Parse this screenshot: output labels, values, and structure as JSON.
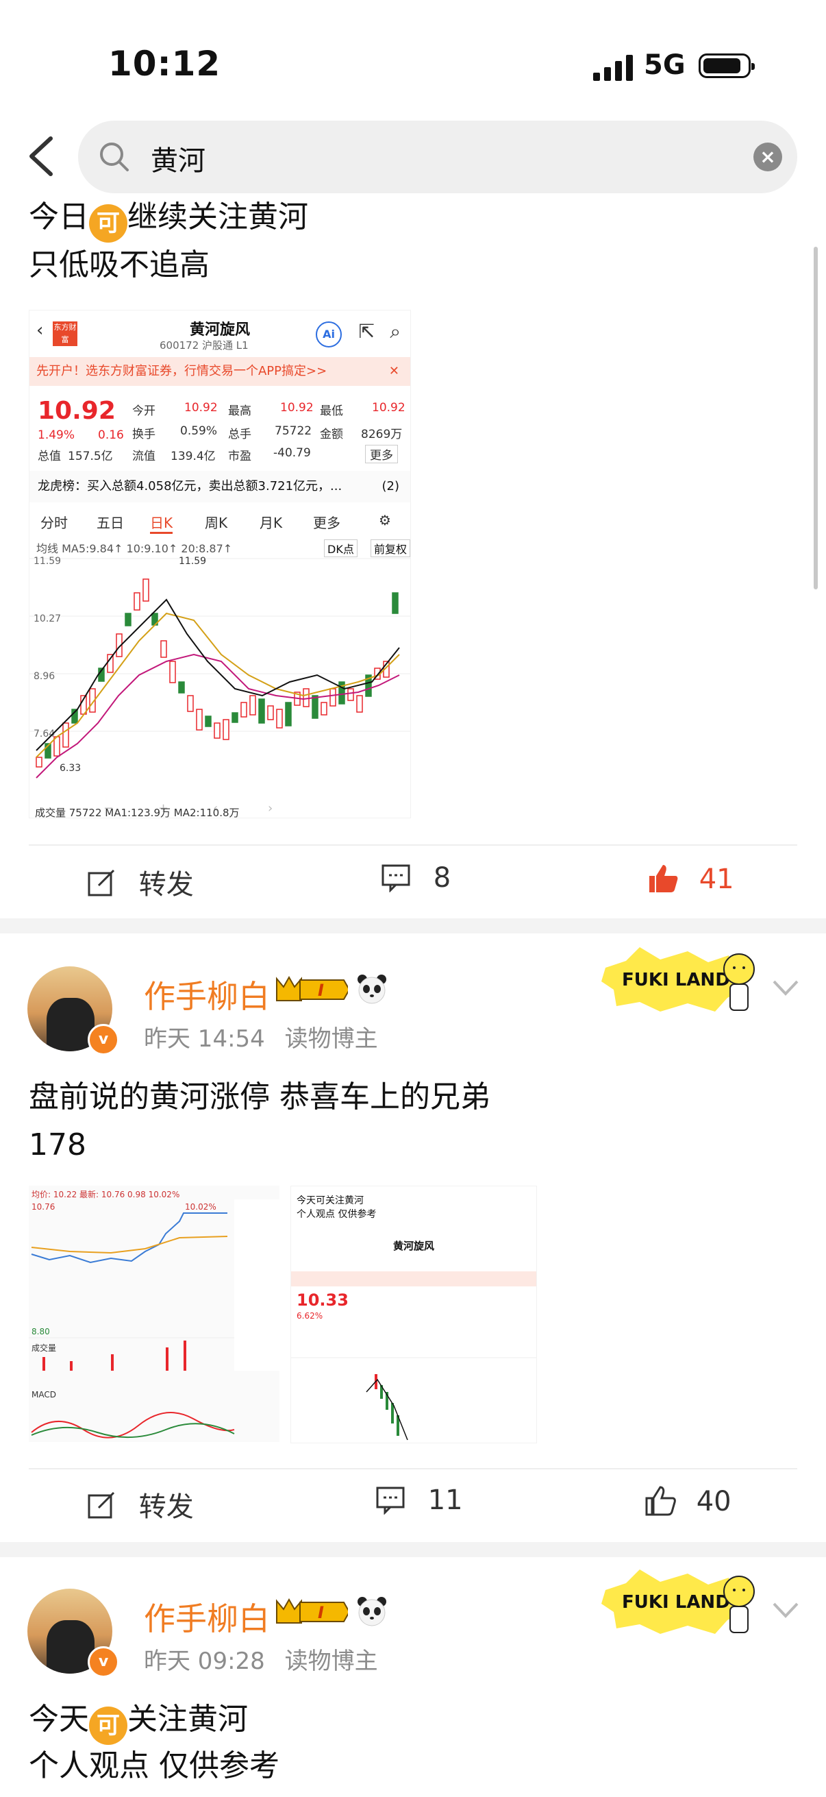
{
  "status_bar": {
    "time": "10:12",
    "network": "5G"
  },
  "search": {
    "query": "黄河"
  },
  "post1": {
    "line1_a": "今日",
    "line1_icon": "可",
    "line1_b": "继续关注黄河",
    "line2": "只低吸不追高",
    "card": {
      "logo": "东方财富",
      "stock_name": "黄河旋风",
      "stock_code": "600172 沪股通 L1",
      "banner": "先开户！选东方财富证券，行情交易一个APP搞定>>",
      "price": "10.92",
      "pct": "1.49%",
      "change": "0.16",
      "fields": [
        {
          "k": "今开",
          "v": "10.92"
        },
        {
          "k": "最高",
          "v": "10.92"
        },
        {
          "k": "最低",
          "v": "10.92"
        },
        {
          "k": "换手",
          "v": "0.59%"
        },
        {
          "k": "总手",
          "v": "75722"
        },
        {
          "k": "金额",
          "v": "8269万"
        },
        {
          "k": "总值",
          "v": "157.5亿"
        },
        {
          "k": "流值",
          "v": "139.4亿"
        },
        {
          "k": "市盈",
          "v": "-40.79"
        }
      ],
      "more": "更多",
      "dragon": "龙虎榜：买入总额4.058亿元，卖出总额3.721亿元，...",
      "dragon_count": "(2)",
      "tabs": [
        "分时",
        "五日",
        "日K",
        "周K",
        "月K",
        "更多"
      ],
      "ma_line": "均线 MA5:9.84↑ 10:9.10↑ 20:8.87↑",
      "dk": "DK点",
      "fq": "前复权",
      "y_ticks": [
        "11.59",
        "10.27",
        "8.96",
        "7.64"
      ],
      "hi_label": "11.59",
      "lo_label": "6.33",
      "volume_line": "成交量 75722 MA1:123.9万 MA2:110.8万"
    },
    "actions": {
      "repost": "转发",
      "comments": "8",
      "likes": "41"
    }
  },
  "post2": {
    "author": "作手柳白",
    "level": "I",
    "time": "昨天 14:54",
    "role": "读物博主",
    "decor": "FUKI LAND",
    "text_line1": "盘前说的黄河涨停 恭喜车上的兄弟",
    "text_line2": "178",
    "thumb1_top": "均价: 10.22 最新: 10.76 0.98 10.02%",
    "thumb1_hi": "10.76",
    "thumb1_pct": "10.02%",
    "thumb1_lo": "8.80",
    "thumb1_vol": "成交量",
    "thumb1_macd": "MACD",
    "thumb2_l1": "今天可关注黄河",
    "thumb2_l2": "个人观点 仅供参考",
    "thumb2_name": "黄河旋风",
    "thumb2_price": "10.33",
    "thumb2_pct": "6.62%",
    "actions": {
      "repost": "转发",
      "comments": "11",
      "likes": "40"
    }
  },
  "post3": {
    "author": "作手柳白",
    "level": "I",
    "time": "昨天 09:28",
    "role": "读物博主",
    "decor": "FUKI LAND",
    "line1_a": "今天",
    "line1_icon": "可",
    "line1_b": "关注黄河",
    "line2": "个人观点 仅供参考"
  },
  "colors": {
    "accent": "#f07c22",
    "like_red": "#e8492b",
    "up_red": "#e8262b"
  }
}
